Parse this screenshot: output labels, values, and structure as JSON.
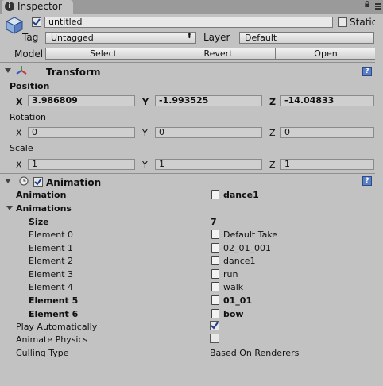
{
  "tab": {
    "title": "Inspector"
  },
  "object": {
    "name": "untitled",
    "static_label": "Static",
    "tag_label": "Tag",
    "tag_value": "Untagged",
    "layer_label": "Layer",
    "layer_value": "Default",
    "model_label": "Model",
    "model_buttons": [
      "Select",
      "Revert",
      "Open"
    ]
  },
  "transform": {
    "title": "Transform",
    "position": {
      "label": "Position",
      "x": "3.986809",
      "y": "-1.993525",
      "z": "-14.04833"
    },
    "rotation": {
      "label": "Rotation",
      "x": "0",
      "y": "0",
      "z": "0"
    },
    "scale": {
      "label": "Scale",
      "x": "1",
      "y": "1",
      "z": "1"
    },
    "axis_labels": [
      "X",
      "Y",
      "Z"
    ]
  },
  "animation": {
    "title": "Animation",
    "animation_label": "Animation",
    "animation_value": "dance1",
    "animations_label": "Animations",
    "size_label": "Size",
    "size_value": "7",
    "elements": [
      {
        "label": "Element 0",
        "value": "Default Take",
        "bold": false
      },
      {
        "label": "Element 1",
        "value": "02_01_001",
        "bold": false
      },
      {
        "label": "Element 2",
        "value": "dance1",
        "bold": false
      },
      {
        "label": "Element 3",
        "value": "run",
        "bold": false
      },
      {
        "label": "Element 4",
        "value": "walk",
        "bold": false
      },
      {
        "label": "Element 5",
        "value": "01_01",
        "bold": true
      },
      {
        "label": "Element 6",
        "value": "bow",
        "bold": true
      }
    ],
    "play_auto_label": "Play Automatically",
    "play_auto_checked": true,
    "animate_physics_label": "Animate Physics",
    "animate_physics_checked": false,
    "culling_label": "Culling Type",
    "culling_value": "Based On Renderers"
  }
}
